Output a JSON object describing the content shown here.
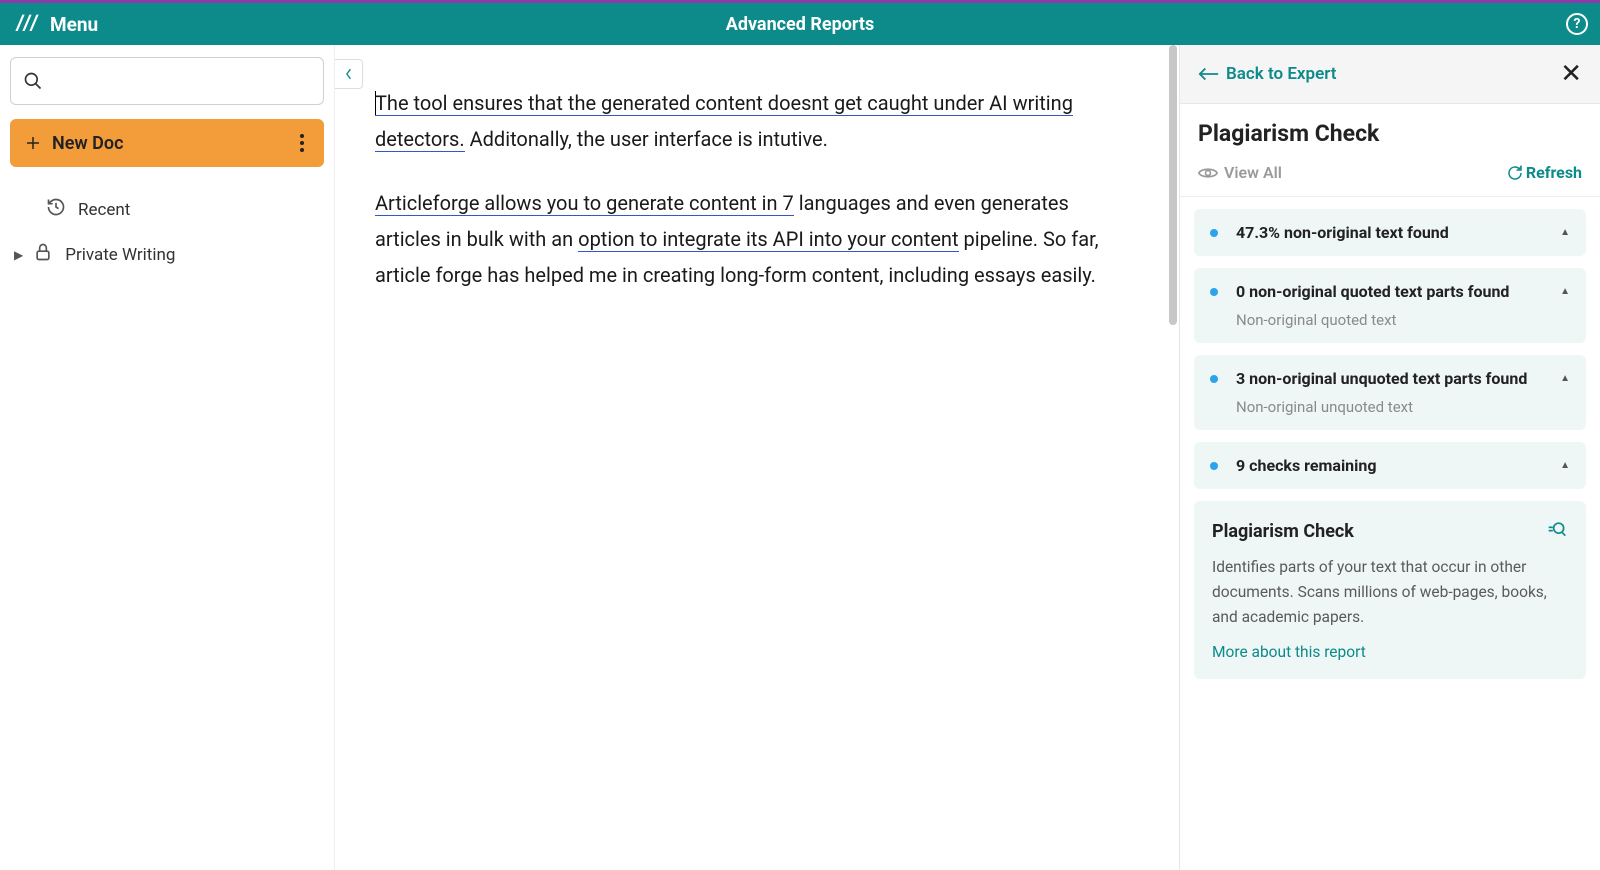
{
  "header": {
    "menu_label": "Menu",
    "title": "Advanced Reports",
    "help_glyph": "?"
  },
  "sidebar": {
    "search_placeholder": "",
    "new_doc_label": "New Doc",
    "recent_label": "Recent",
    "private_label": "Private Writing"
  },
  "editor": {
    "p1_u1": "The tool ensures that the generated content doesnt get caught under ",
    "p1_u2": "AI writing detectors.",
    "p1_tail": " Additonally, the user interface is intutive.",
    "p2_u1": "Articleforge allows you to generate content in 7",
    "p2_mid1": " languages and even generates articles in bulk with an ",
    "p2_u2": "option to integrate its API into your ",
    "p2_u3": "content",
    "p2_tail": " pipeline. So far, article forge has helped me in creating long-form content, including essays easily."
  },
  "panel": {
    "back_label": "Back to Expert",
    "title": "Plagiarism Check",
    "view_all_label": "View All",
    "refresh_label": "Refresh",
    "cards": [
      {
        "title": "47.3% non-original text found",
        "sub": ""
      },
      {
        "title": "0 non-original quoted text parts found",
        "sub": "Non-original quoted text"
      },
      {
        "title": "3 non-original unquoted text parts found",
        "sub": "Non-original unquoted text"
      },
      {
        "title": "9 checks remaining",
        "sub": ""
      }
    ],
    "info_title": "Plagiarism Check",
    "info_desc": "Identifies parts of your text that occur in other documents. Scans millions of web-pages, books, and academic papers.",
    "info_link": "More about this report"
  }
}
